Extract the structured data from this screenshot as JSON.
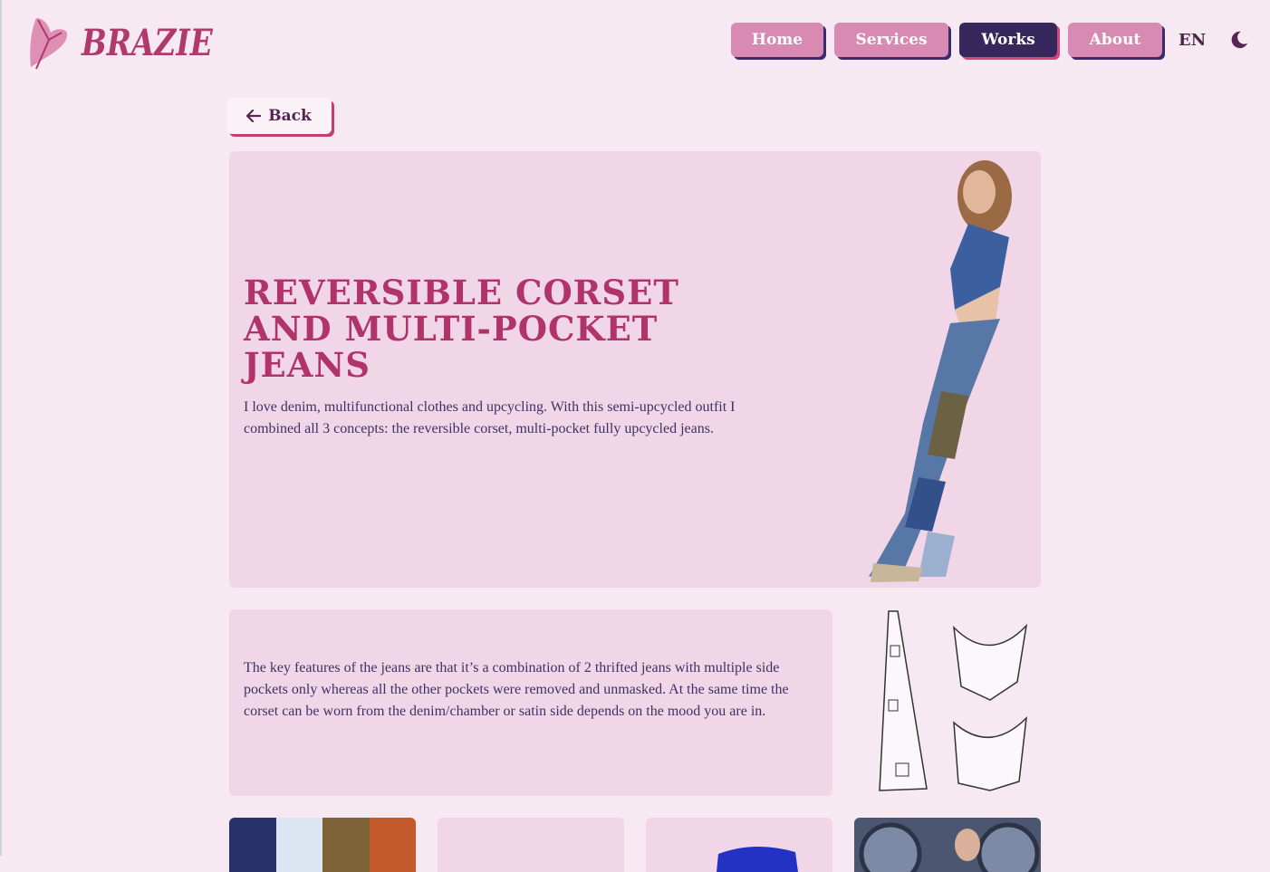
{
  "brand": {
    "name": "BRAZIE",
    "colors": {
      "primary": "#b03a6e",
      "nav": "#d98ab3",
      "active": "#36275d"
    }
  },
  "nav": {
    "items": [
      {
        "label": "Home",
        "active": false
      },
      {
        "label": "Services",
        "active": false
      },
      {
        "label": "Works",
        "active": true
      },
      {
        "label": "About",
        "active": false
      }
    ],
    "language": "EN",
    "theme_icon": "moon-icon"
  },
  "back": {
    "label": "Back",
    "icon": "arrow-left-icon"
  },
  "project": {
    "title": "Reversible corset and multi-pocket jeans",
    "intro": "I love denim, multifunctional clothes and upcycling. With this semi-upcycled outfit I combined all 3 concepts: the reversible corset, multi-pocket fully upcycled jeans.",
    "features": "The key features of the jeans are that it’s a combination of 2 thrifted jeans with multiple side pockets only whereas all the other pockets were removed and unmasked. At the same time the corset can be worn from the denim/chamber or satin side depends on the mood you are in."
  },
  "palette": [
    "#27326b",
    "#dde4f2",
    "#7e6338",
    "#c35a2c"
  ]
}
